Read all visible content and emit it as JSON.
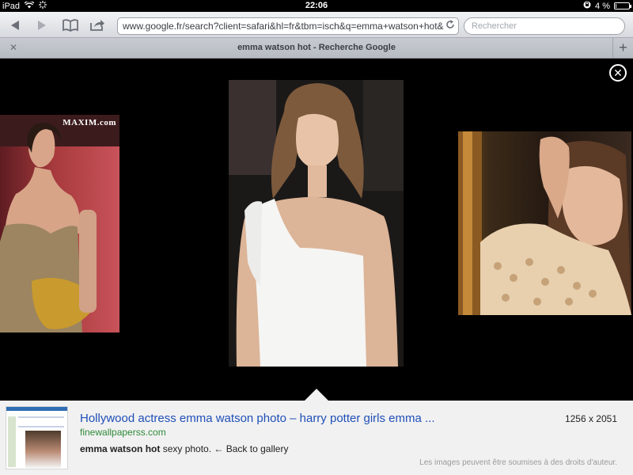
{
  "status_bar": {
    "device": "iPad",
    "time": "22:06",
    "battery_percent": "4 %",
    "battery_level": 0.04
  },
  "toolbar": {
    "back_icon": "back-arrow-icon",
    "forward_icon": "forward-arrow-icon",
    "bookmarks_icon": "bookmarks-icon",
    "share_icon": "share-icon",
    "url": "www.google.fr/search?client=safari&hl=fr&tbm=isch&q=emma+watson+hot&",
    "search_placeholder": "Rechercher"
  },
  "tab_bar": {
    "title": "emma watson hot - Recherche Google"
  },
  "viewer": {
    "left_image_watermark": "MAXIM.com"
  },
  "result": {
    "title": "Hollywood actress emma watson photo – harry potter girls emma ...",
    "dimensions": "1256 x 2051",
    "domain": "finewallpaperss.com",
    "desc_bold": "emma watson hot",
    "desc_rest": " sexy photo.",
    "back_link": "← Back to gallery",
    "copyright": "Les images peuvent être soumises à des droits d'auteur."
  }
}
